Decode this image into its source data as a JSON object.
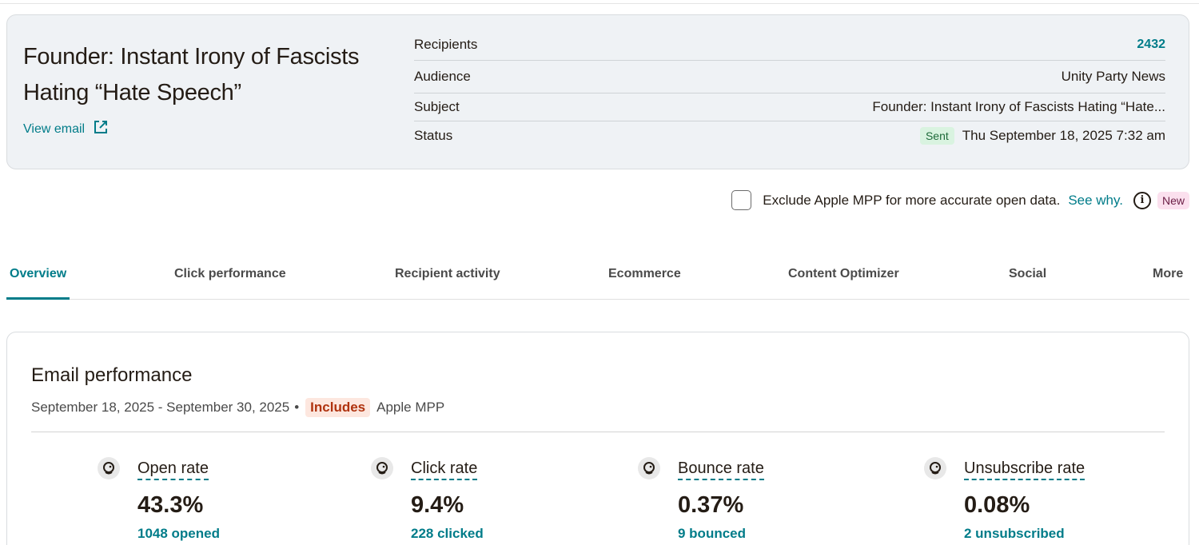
{
  "summary": {
    "title": "Founder: Instant Irony of Fascists Hating “Hate Speech”",
    "view_email": "View email",
    "rows": [
      {
        "label": "Recipients",
        "value": "2432"
      },
      {
        "label": "Audience",
        "value": "Unity Party News"
      },
      {
        "label": "Subject",
        "value": "Founder: Instant Irony of Fascists Hating “Hate..."
      },
      {
        "label": "Status",
        "badge": "Sent",
        "value": "Thu September 18, 2025 7:32 am"
      }
    ]
  },
  "mpp": {
    "label": "Exclude Apple MPP for more accurate open data.",
    "link": "See why.",
    "badge": "New"
  },
  "tabs": [
    {
      "label": "Overview"
    },
    {
      "label": "Click performance"
    },
    {
      "label": "Recipient activity"
    },
    {
      "label": "Ecommerce"
    },
    {
      "label": "Content Optimizer"
    },
    {
      "label": "Social"
    },
    {
      "label": "More"
    }
  ],
  "performance": {
    "title": "Email performance",
    "date_range": "September 18, 2025 - September 30, 2025",
    "separator": "•",
    "includes_badge": "Includes",
    "includes_text": "Apple MPP",
    "stats": [
      {
        "label": "Open rate",
        "value": "43.3%",
        "sub": "1048 opened"
      },
      {
        "label": "Click rate",
        "value": "9.4%",
        "sub": "228 clicked"
      },
      {
        "label": "Bounce rate",
        "value": "0.37%",
        "sub": "9 bounced"
      },
      {
        "label": "Unsubscribe rate",
        "value": "0.08%",
        "sub": "2 unsubscribed"
      }
    ]
  },
  "colors": {
    "accent": "#007c89",
    "card_bg": "#eff2f5",
    "sent_badge": "#d9f3e0",
    "new_badge": "#fbe0ee",
    "includes_badge": "#fde7df"
  },
  "icons": {
    "view_email": "external-link-icon",
    "info": "info-icon",
    "stat": "mailchimp-logo-icon"
  }
}
